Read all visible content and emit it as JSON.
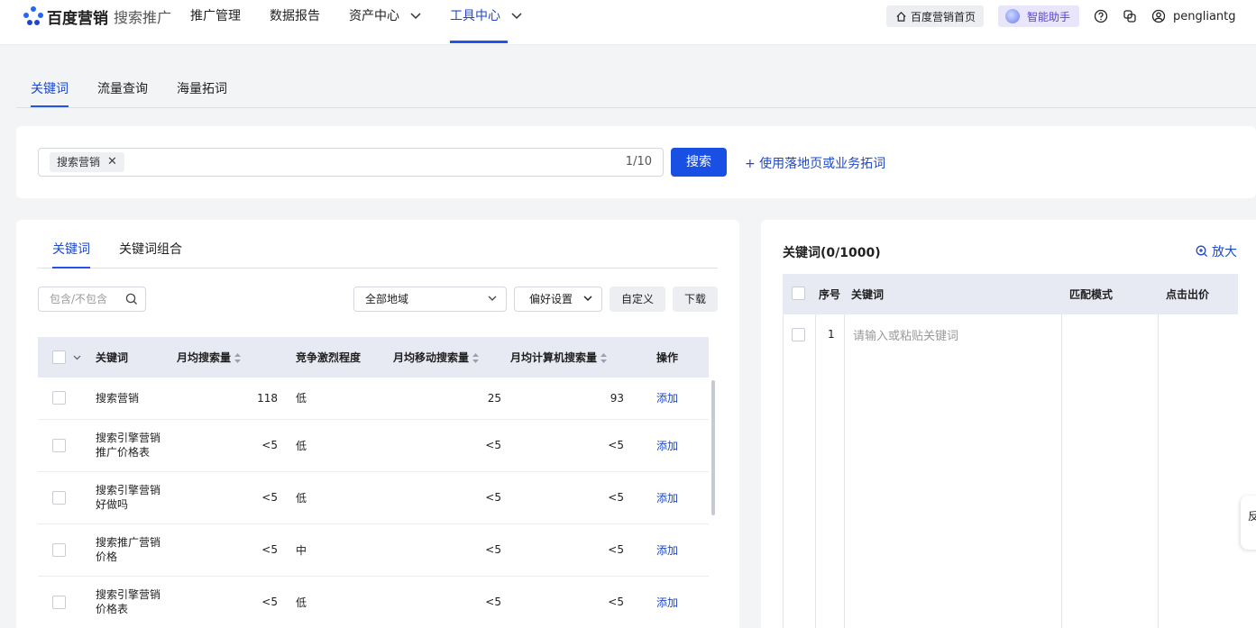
{
  "brand": {
    "name": "百度营销",
    "product": "搜索推广",
    "color": "#2468f2"
  },
  "nav": {
    "items": [
      {
        "label": "推广管理",
        "has_menu": false,
        "active": false
      },
      {
        "label": "数据报告",
        "has_menu": false,
        "active": false
      },
      {
        "label": "资产中心",
        "has_menu": true,
        "active": false
      },
      {
        "label": "工具中心",
        "has_menu": true,
        "active": true
      }
    ],
    "home_label": "百度营销首页",
    "assistant_label": "智能助手",
    "help_icon": "help-circle-icon",
    "switch_icon": "switch-account-icon",
    "user_icon": "user-circle-icon",
    "username": "pengliantg"
  },
  "main_tabs": [
    "关键词",
    "流量查询",
    "海量拓词"
  ],
  "search": {
    "tag": "搜索营销",
    "counter": "1/10",
    "button": "搜索",
    "landing_link": "+ 使用落地页或业务拓词"
  },
  "left": {
    "tabs": [
      "关键词",
      "关键词组合"
    ],
    "filter_placeholder": "包含/不包含",
    "region_select": "全部地域",
    "pref_select": "偏好设置",
    "custom_button": "自定义",
    "download_button": "下载",
    "columns": [
      "关键词",
      "月均搜索量",
      "竞争激烈程度",
      "月均移动搜索量",
      "月均计算机搜索量",
      "操作"
    ],
    "rows": [
      {
        "kw": "搜索营销",
        "search": "118",
        "comp": "低",
        "mobile": "25",
        "pc": "93",
        "action": "添加"
      },
      {
        "kw": "搜索引擎营销推广价格表",
        "search": "<5",
        "comp": "低",
        "mobile": "<5",
        "pc": "<5",
        "action": "添加"
      },
      {
        "kw": "搜索引擎营销好做吗",
        "search": "<5",
        "comp": "低",
        "mobile": "<5",
        "pc": "<5",
        "action": "添加"
      },
      {
        "kw": "搜索推广营销价格",
        "search": "<5",
        "comp": "中",
        "mobile": "<5",
        "pc": "<5",
        "action": "添加"
      },
      {
        "kw": "搜索引擎营销价格表",
        "search": "<5",
        "comp": "低",
        "mobile": "<5",
        "pc": "<5",
        "action": "添加"
      }
    ]
  },
  "right": {
    "title": "关键词(0/1000)",
    "zoom_label": "放大",
    "columns": [
      "序号",
      "关键词",
      "匹配模式",
      "点击出价"
    ],
    "row_index": "1",
    "placeholder": "请输入或粘贴关键词"
  },
  "feedback": "反"
}
